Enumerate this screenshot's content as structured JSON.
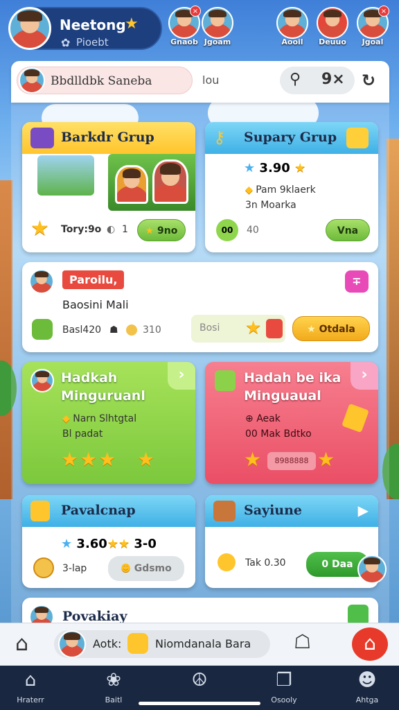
{
  "header": {
    "player_name": "Neetong",
    "player_sub": "Pioebt",
    "friends": [
      {
        "name": "Gnaob",
        "badge": "×"
      },
      {
        "name": "Jgoam",
        "badge": ""
      },
      {
        "name": "Aooil",
        "badge": ""
      },
      {
        "name": "Deuuo",
        "badge": ""
      },
      {
        "name": "Jgoal",
        "badge": "×"
      }
    ]
  },
  "search": {
    "pill_label": "Bbdlldbk Saneba",
    "text": "lou",
    "search_icon": "search-icon",
    "filter_label": "9×"
  },
  "cards": {
    "c1": {
      "title": "Barkdr Grup",
      "score_label": "Tory:9o",
      "count": "1",
      "button": "9no"
    },
    "c2": {
      "title": "Supary Grup",
      "rating": "3.90",
      "line1": "Pam 9klaerk",
      "line2": "3n Moarka",
      "badge": "00",
      "value": "40",
      "button": "Vna"
    },
    "c3": {
      "tag": "Paroilu,",
      "subtitle": "Baosini Mali",
      "stats": "Basl420",
      "coin_value": "310",
      "input": "Bosi",
      "button": "Otdala"
    },
    "c4": {
      "title_line1": "Hadkah",
      "title_line2": "Minguruanl",
      "line1": "Narn Slhtgtal",
      "line2": "Bl padat"
    },
    "c5": {
      "title_line1": "Hadah be ika",
      "title_line2": "Minguaual",
      "line1": "Aeak",
      "line2": "00 Mak Bdtko",
      "bar_text": "8988888"
    },
    "c6": {
      "title": "Pavalcnap",
      "rating": "3.60",
      "rating2": "3-0",
      "label": "3-lap",
      "button": "Gdsmo"
    },
    "c7": {
      "title": "Sayiune",
      "label": "Tak 0.30",
      "button": "0 Daa"
    },
    "c8": {
      "title": "Povakiay"
    }
  },
  "actionbar": {
    "label": "Aotk:",
    "pill": "Niomdanala Bara"
  },
  "nav": [
    {
      "label": "Hraterr",
      "icon": "home-icon"
    },
    {
      "label": "Baitl",
      "icon": "paw-icon"
    },
    {
      "label": "",
      "icon": "peace-icon"
    },
    {
      "label": "Osooly",
      "icon": "cards-icon"
    },
    {
      "label": "Ahtga",
      "icon": "user-icon"
    }
  ],
  "colors": {
    "yellow_head": "#ffcf3a",
    "blue_head": "#5cc4f0",
    "green_card": "#8fd64c",
    "pink_card": "#f2647a",
    "navbar": "#1a2740"
  }
}
